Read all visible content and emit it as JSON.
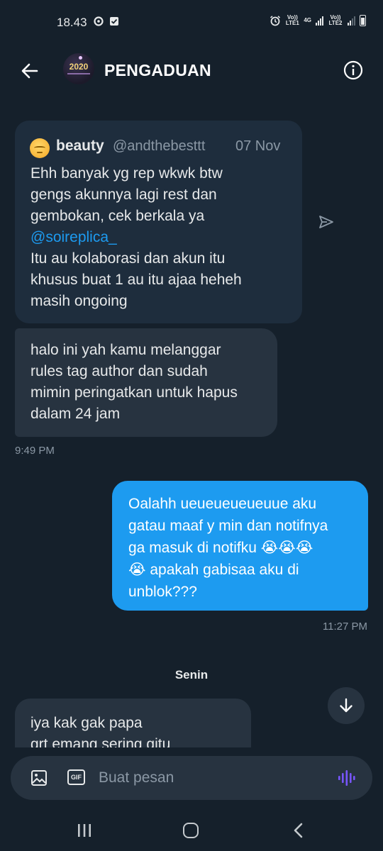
{
  "status_bar": {
    "time": "18.43",
    "sim1_label": "Vo)) LTE1",
    "net_type": "4G",
    "sim2_label": "Vo)) LTE2"
  },
  "header": {
    "back_icon": "arrow-left-icon",
    "avatar_text": "2020",
    "title": "PENGADUAN",
    "info_icon": "info-circle-icon"
  },
  "quoted_post": {
    "name": "beauty",
    "handle": "@andthebesttt",
    "date": "07 Nov",
    "lines": [
      "Ehh banyak yg rep wkwk btw",
      "gengs akunnya lagi rest dan",
      "gembokan, cek berkala ya",
      "@soireplica_",
      "Itu au kolaborasi dan akun itu",
      "khusus buat 1 au itu ajaa heheh",
      "masih ongoing"
    ],
    "mention": "@soireplica_",
    "share_icon": "send-icon"
  },
  "messages": [
    {
      "direction": "incoming",
      "lines": [
        "halo ini yah kamu melanggar",
        "rules tag author dan sudah",
        "mimin peringatkan untuk hapus",
        "dalam 24 jam"
      ],
      "time": "9:49 PM"
    },
    {
      "direction": "outgoing",
      "lines": [
        "Oalahh ueueueueueuue aku",
        "gatau  maaf y min dan notifnya",
        "ga masuk di notifku 😭😭😭",
        "😭 apakah gabisaa  aku di",
        "unblok???"
      ],
      "time": "11:27 PM"
    },
    {
      "direction": "incoming",
      "lines": [
        "iya kak gak papa",
        "grt emang sering gitu"
      ]
    }
  ],
  "day_separator": "Senin",
  "composer": {
    "placeholder": "Buat pesan",
    "image_icon": "image-icon",
    "gif_label": "GIF",
    "voice_icon": "voice-wave-icon"
  },
  "colors": {
    "background": "#15202b",
    "incoming_bubble": "#273340",
    "outgoing_bubble": "#1d9bf0",
    "mention": "#1d9bf0",
    "voice_accent": "#7856ff"
  }
}
